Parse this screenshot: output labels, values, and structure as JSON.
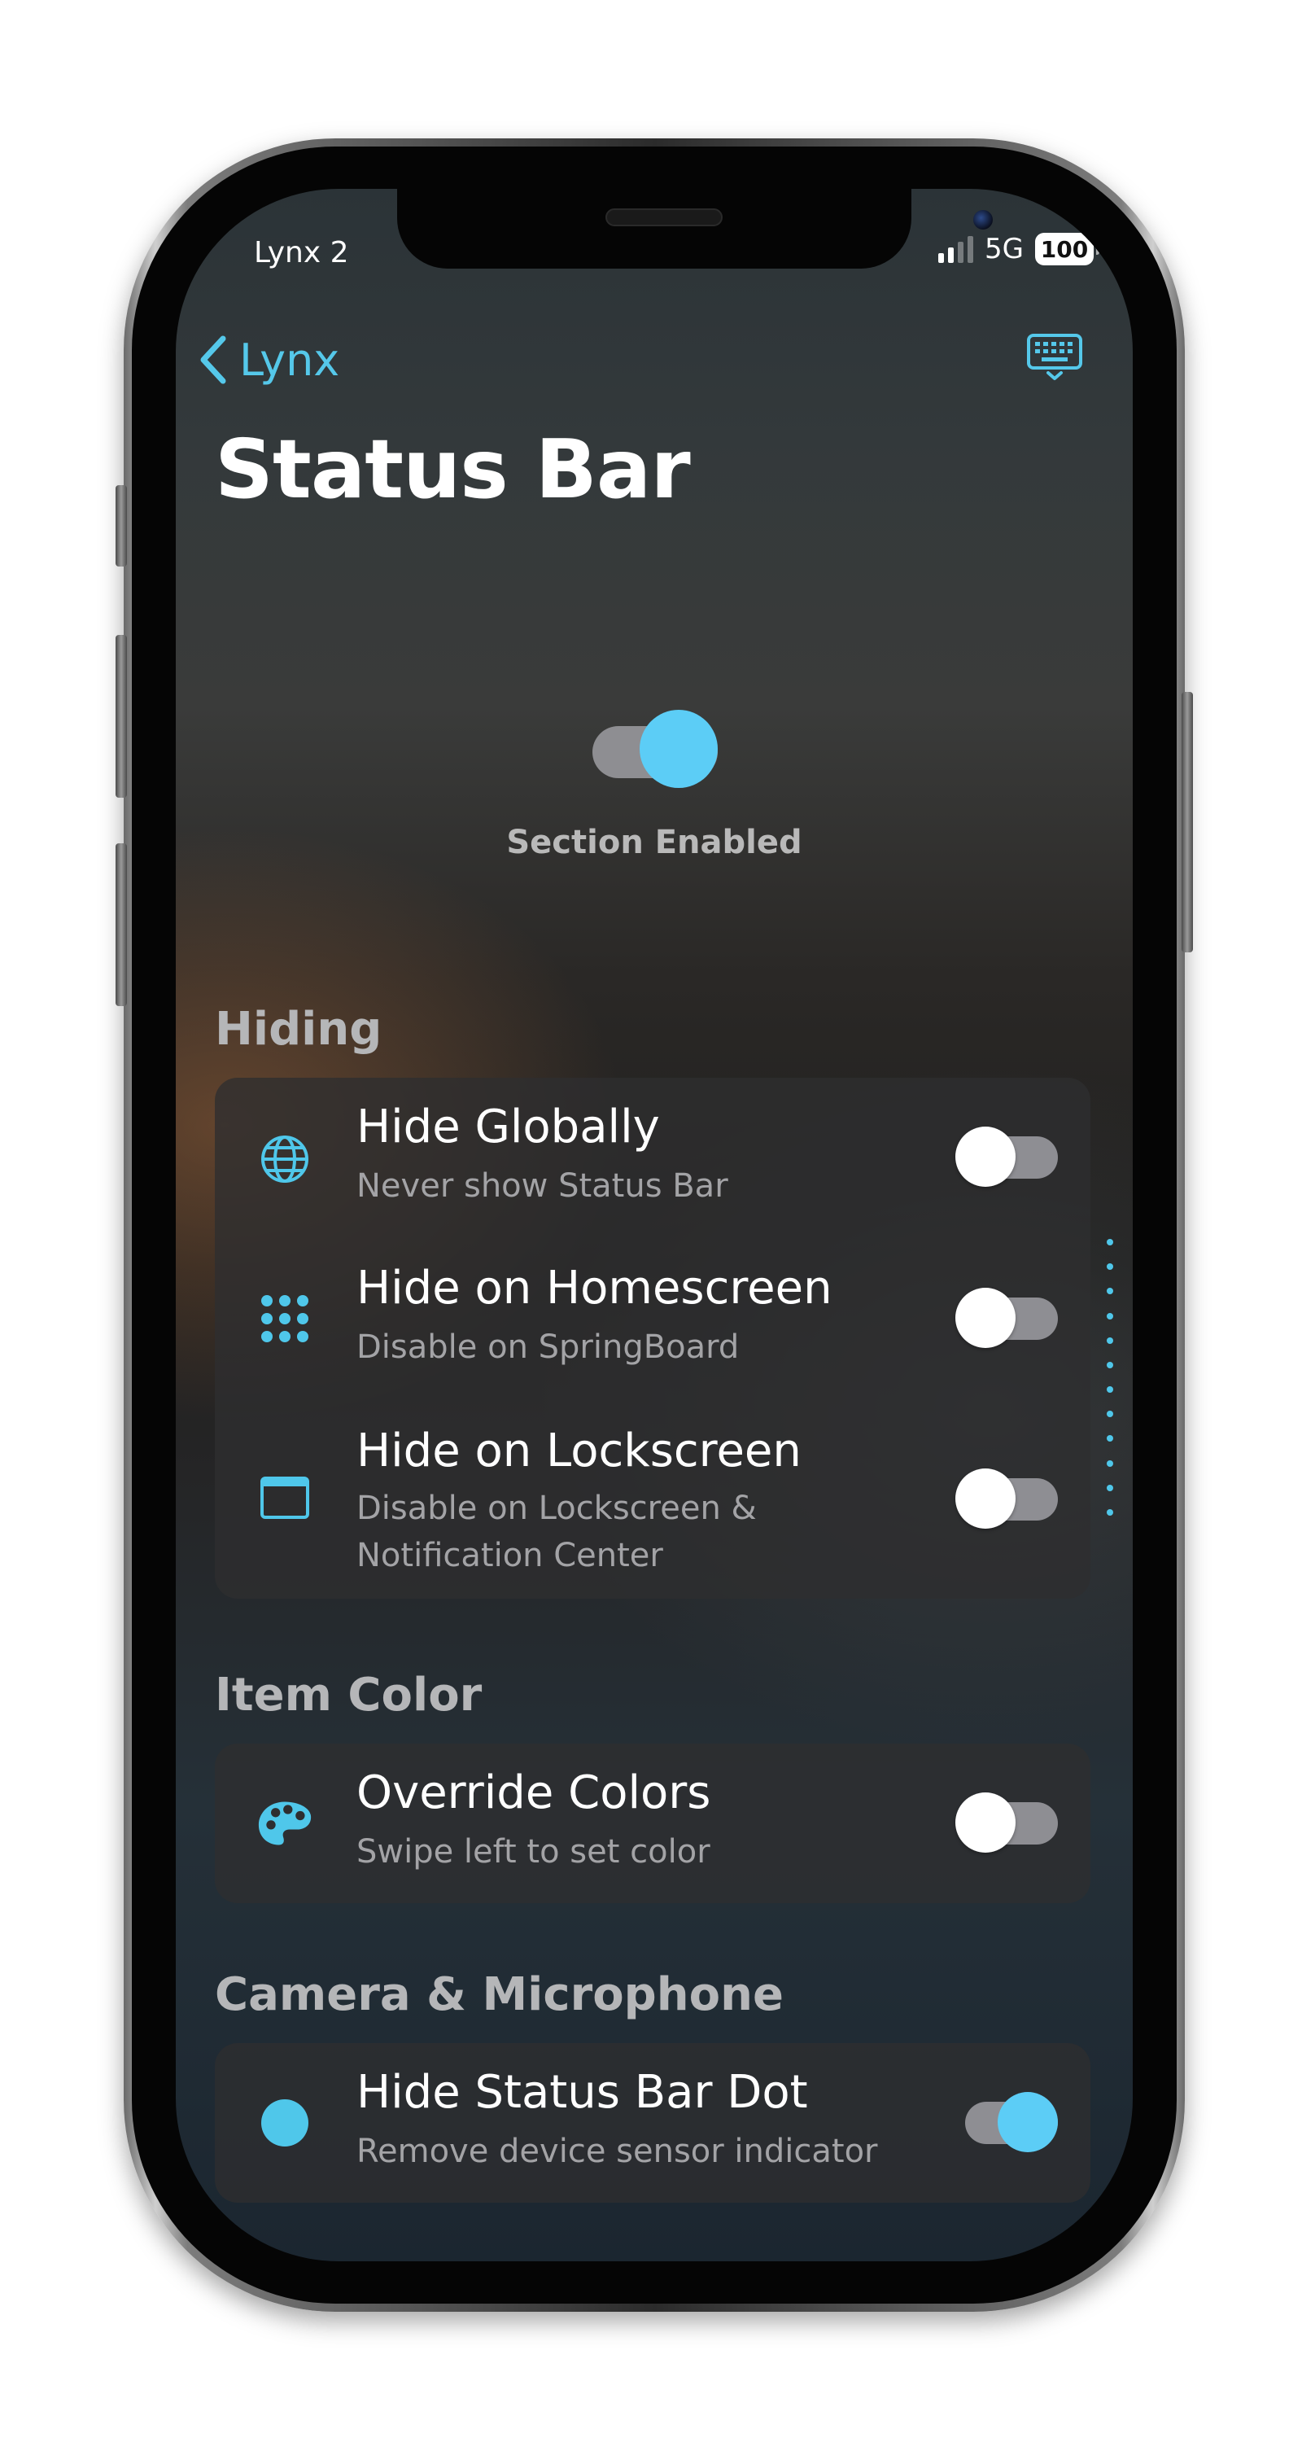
{
  "status_bar": {
    "carrier": "Lynx 2",
    "network": "5G",
    "battery": "100",
    "signal_bars_active": 2
  },
  "nav": {
    "back_label": "Lynx",
    "back_icon": "chevron-left-icon",
    "right_icon": "keyboard-icon"
  },
  "page": {
    "title": "Status Bar"
  },
  "master": {
    "label": "Section Enabled",
    "enabled": true
  },
  "sections": {
    "hiding": {
      "header": "Hiding",
      "rows": [
        {
          "title": "Hide Globally",
          "subtitle": "Never show Status Bar",
          "icon": "globe-icon",
          "on": false
        },
        {
          "title": "Hide on Homescreen",
          "subtitle": "Disable on SpringBoard",
          "icon": "app-grid-icon",
          "on": false
        },
        {
          "title": "Hide on Lockscreen",
          "subtitle": "Disable on Lockscreen & Notification Center",
          "icon": "window-icon",
          "on": false
        }
      ]
    },
    "item_color": {
      "header": "Item Color",
      "rows": [
        {
          "title": "Override Colors",
          "subtitle": "Swipe left to set color",
          "icon": "palette-icon",
          "on": false
        }
      ]
    },
    "camera_mic": {
      "header": "Camera & Microphone",
      "rows": [
        {
          "title": "Hide Status Bar Dot",
          "subtitle": "Remove device sensor indicator",
          "icon": "dot-icon",
          "on": true
        }
      ]
    }
  },
  "colors": {
    "accent": "#55c8ea",
    "toggle_on": "#5ccdf6",
    "toggle_track": "#8e8e93",
    "card_bg": "#2e2e30"
  }
}
